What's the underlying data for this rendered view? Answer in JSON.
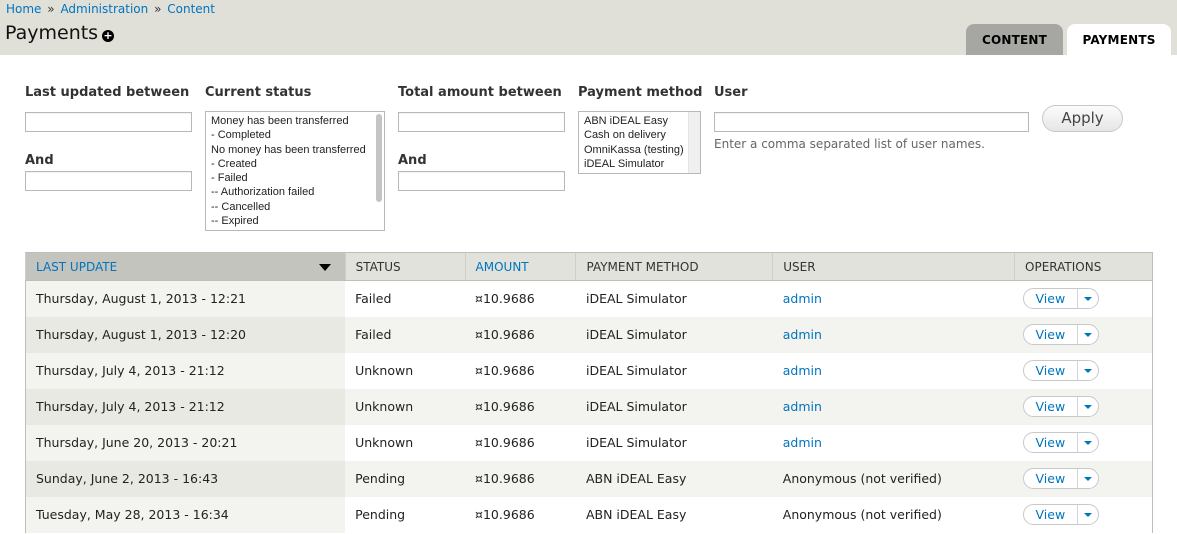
{
  "breadcrumb": [
    {
      "label": "Home"
    },
    {
      "label": "Administration"
    },
    {
      "label": "Content"
    }
  ],
  "breadcrumb_separator": "»",
  "page": {
    "title": "Payments",
    "add_icon": "plus-circle-icon"
  },
  "tabs": [
    {
      "label": "CONTENT",
      "active": false
    },
    {
      "label": "PAYMENTS",
      "active": true
    }
  ],
  "filters": {
    "last_updated": {
      "label": "Last updated between",
      "value": "",
      "and_label": "And",
      "and_value": ""
    },
    "current_status": {
      "label": "Current status",
      "options": [
        "Money has been transferred",
        "- Completed",
        "No money has been transferred",
        "- Created",
        "- Failed",
        "-- Authorization failed",
        "-- Cancelled",
        "-- Expired"
      ]
    },
    "total_amount": {
      "label": "Total amount between",
      "value": "",
      "and_label": "And",
      "and_value": ""
    },
    "payment_method": {
      "label": "Payment method",
      "options": [
        "ABN iDEAL Easy",
        "Cash on delivery",
        "OmniKassa (testing)",
        "iDEAL Simulator"
      ]
    },
    "user": {
      "label": "User",
      "value": "",
      "description": "Enter a comma separated list of user names."
    },
    "apply_label": "Apply"
  },
  "table": {
    "columns": [
      "LAST UPDATE",
      "STATUS",
      "AMOUNT",
      "PAYMENT METHOD",
      "USER",
      "OPERATIONS"
    ],
    "sorted_column": "LAST UPDATE",
    "rows": [
      {
        "last_update": "Thursday, August 1, 2013 - 12:21",
        "status": "Failed",
        "amount": "¤10.9686",
        "method": "iDEAL Simulator",
        "user": "admin",
        "user_link": true,
        "op": "View"
      },
      {
        "last_update": "Thursday, August 1, 2013 - 12:20",
        "status": "Failed",
        "amount": "¤10.9686",
        "method": "iDEAL Simulator",
        "user": "admin",
        "user_link": true,
        "op": "View"
      },
      {
        "last_update": "Thursday, July 4, 2013 - 21:12",
        "status": "Unknown",
        "amount": "¤10.9686",
        "method": "iDEAL Simulator",
        "user": "admin",
        "user_link": true,
        "op": "View"
      },
      {
        "last_update": "Thursday, July 4, 2013 - 21:12",
        "status": "Unknown",
        "amount": "¤10.9686",
        "method": "iDEAL Simulator",
        "user": "admin",
        "user_link": true,
        "op": "View"
      },
      {
        "last_update": "Thursday, June 20, 2013 - 20:21",
        "status": "Unknown",
        "amount": "¤10.9686",
        "method": "iDEAL Simulator",
        "user": "admin",
        "user_link": true,
        "op": "View"
      },
      {
        "last_update": "Sunday, June 2, 2013 - 16:43",
        "status": "Pending",
        "amount": "¤10.9686",
        "method": "ABN iDEAL Easy",
        "user": "Anonymous (not verified)",
        "user_link": false,
        "op": "View"
      },
      {
        "last_update": "Tuesday, May 28, 2013 - 16:34",
        "status": "Pending",
        "amount": "¤10.9686",
        "method": "ABN iDEAL Easy",
        "user": "Anonymous (not verified)",
        "user_link": false,
        "op": "View"
      }
    ]
  },
  "colors": {
    "link": "#0074bd",
    "header_bg": "#e0e0d8",
    "tab_inactive": "#a6a7a2",
    "sorted_header": "#c4c4bf",
    "row_stripe": "#f3f3ef"
  }
}
